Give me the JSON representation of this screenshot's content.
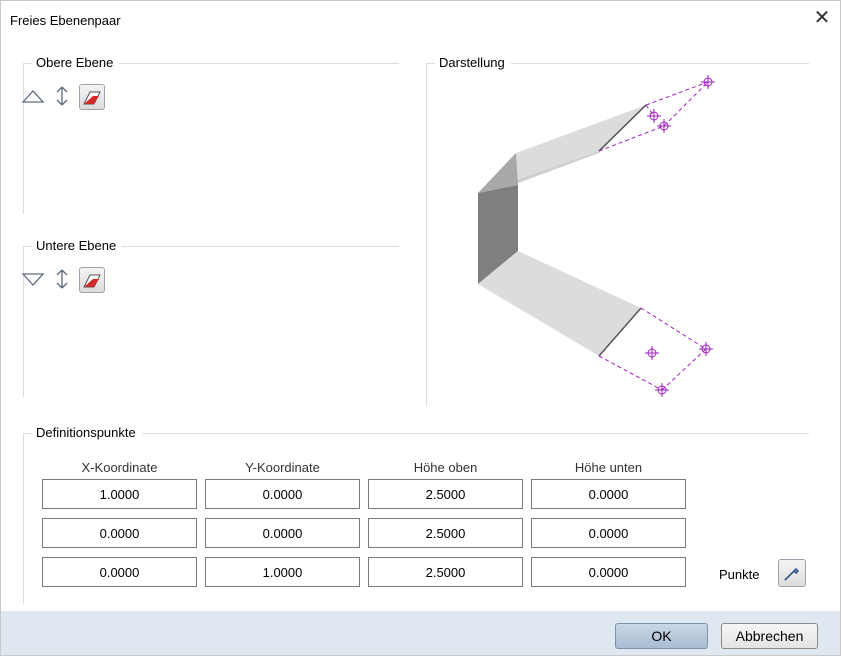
{
  "window": {
    "title": "Freies Ebenenpaar",
    "close_glyph": "✕"
  },
  "upper": {
    "label": "Obere Ebene",
    "icons": [
      "triangle-up-icon",
      "double-arrow-vertical-icon",
      "plane-red-icon"
    ]
  },
  "lower": {
    "label": "Untere Ebene",
    "icons": [
      "triangle-down-icon",
      "double-arrow-vertical-icon",
      "plane-red-icon"
    ]
  },
  "preview": {
    "label": "Darstellung"
  },
  "definition": {
    "label": "Definitionspunkte",
    "columns": [
      "X-Koordinate",
      "Y-Koordinate",
      "Höhe oben",
      "Höhe unten"
    ],
    "rows": [
      [
        "1.0000",
        "0.0000",
        "2.5000",
        "0.0000"
      ],
      [
        "0.0000",
        "0.0000",
        "2.5000",
        "0.0000"
      ],
      [
        "0.0000",
        "1.0000",
        "2.5000",
        "0.0000"
      ]
    ],
    "points_label": "Punkte"
  },
  "footer": {
    "ok_label": "OK",
    "cancel_label": "Abbrechen"
  },
  "colors": {
    "footer_bg": "#dfe7f0",
    "accent_purple": "#a020c0",
    "plane_red": "#d22a2a"
  }
}
